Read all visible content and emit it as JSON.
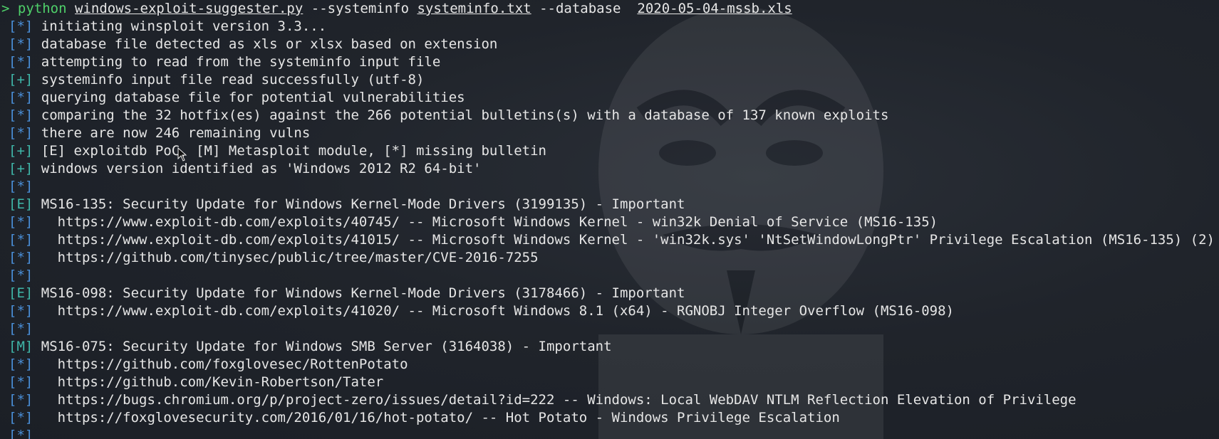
{
  "command": {
    "prompt": ">",
    "program": "python",
    "script": "windows-exploit-suggester.py",
    "arg1": "--systeminfo",
    "arg1_value": "systeminfo.txt",
    "arg2": "--database",
    "arg2_value": "2020-05-04-mssb.xls"
  },
  "output": [
    {
      "tag": "[*]",
      "kind": "star",
      "text": "initiating winsploit version 3.3..."
    },
    {
      "tag": "[*]",
      "kind": "star",
      "text": "database file detected as xls or xlsx based on extension"
    },
    {
      "tag": "[*]",
      "kind": "star",
      "text": "attempting to read from the systeminfo input file"
    },
    {
      "tag": "[+]",
      "kind": "plus",
      "text": "systeminfo input file read successfully (utf-8)"
    },
    {
      "tag": "[*]",
      "kind": "star",
      "text": "querying database file for potential vulnerabilities"
    },
    {
      "tag": "[*]",
      "kind": "star",
      "text": "comparing the 32 hotfix(es) against the 266 potential bulletins(s) with a database of 137 known exploits"
    },
    {
      "tag": "[*]",
      "kind": "star",
      "text": "there are now 246 remaining vulns"
    },
    {
      "tag": "[+]",
      "kind": "plus",
      "text": "[E] exploitdb PoC, [M] Metasploit module, [*] missing bulletin"
    },
    {
      "tag": "[+]",
      "kind": "plus",
      "text": "windows version identified as 'Windows 2012 R2 64-bit'"
    },
    {
      "tag": "[*]",
      "kind": "star",
      "text": ""
    },
    {
      "tag": "[E]",
      "kind": "E",
      "text": "MS16-135: Security Update for Windows Kernel-Mode Drivers (3199135) - Important"
    },
    {
      "tag": "[*]",
      "kind": "star",
      "text": "  https://www.exploit-db.com/exploits/40745/ -- Microsoft Windows Kernel - win32k Denial of Service (MS16-135)"
    },
    {
      "tag": "[*]",
      "kind": "star",
      "text": "  https://www.exploit-db.com/exploits/41015/ -- Microsoft Windows Kernel - 'win32k.sys' 'NtSetWindowLongPtr' Privilege Escalation (MS16-135) (2)"
    },
    {
      "tag": "[*]",
      "kind": "star",
      "text": "  https://github.com/tinysec/public/tree/master/CVE-2016-7255"
    },
    {
      "tag": "[*]",
      "kind": "star",
      "text": ""
    },
    {
      "tag": "[E]",
      "kind": "E",
      "text": "MS16-098: Security Update for Windows Kernel-Mode Drivers (3178466) - Important"
    },
    {
      "tag": "[*]",
      "kind": "star",
      "text": "  https://www.exploit-db.com/exploits/41020/ -- Microsoft Windows 8.1 (x64) - RGNOBJ Integer Overflow (MS16-098)"
    },
    {
      "tag": "[*]",
      "kind": "star",
      "text": ""
    },
    {
      "tag": "[M]",
      "kind": "M",
      "text": "MS16-075: Security Update for Windows SMB Server (3164038) - Important"
    },
    {
      "tag": "[*]",
      "kind": "star",
      "text": "  https://github.com/foxglovesec/RottenPotato"
    },
    {
      "tag": "[*]",
      "kind": "star",
      "text": "  https://github.com/Kevin-Robertson/Tater"
    },
    {
      "tag": "[*]",
      "kind": "star",
      "text": "  https://bugs.chromium.org/p/project-zero/issues/detail?id=222 -- Windows: Local WebDAV NTLM Reflection Elevation of Privilege"
    },
    {
      "tag": "[*]",
      "kind": "star",
      "text": "  https://foxglovesecurity.com/2016/01/16/hot-potato/ -- Hot Potato - Windows Privilege Escalation"
    },
    {
      "tag": "[*]",
      "kind": "star",
      "text": ""
    }
  ],
  "colors": {
    "background": "#1c2027",
    "text": "#e6e6e6",
    "prompt_green": "#4fd06a",
    "tag_blue": "#4a8fd8",
    "tag_teal": "#3fb6a8"
  }
}
